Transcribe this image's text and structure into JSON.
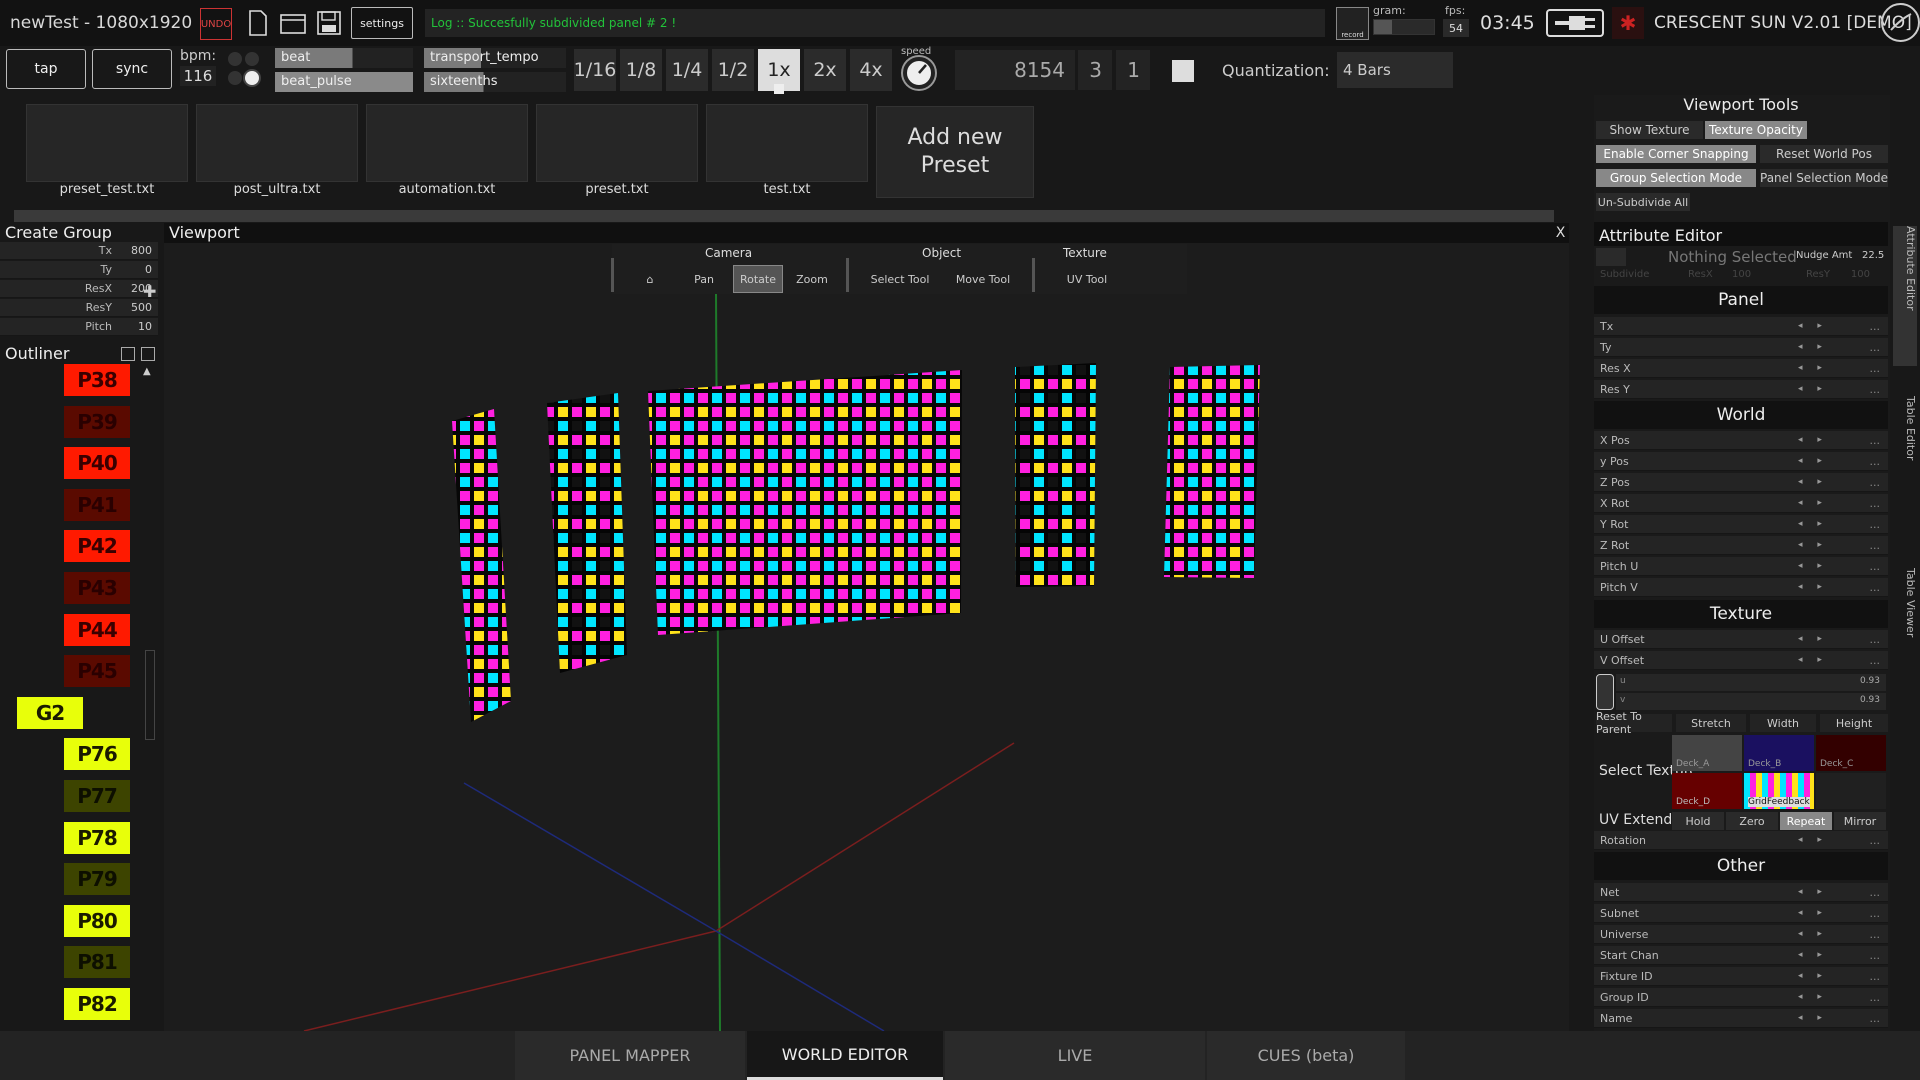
{
  "app": {
    "title": "newTest - 1080x1920",
    "undo_label": "UNDO",
    "settings_label": "settings",
    "log": "Log :: Succesfully subdivided panel # 2 !",
    "record_label": "record",
    "gram_label": "gram:",
    "fps_label": "fps:",
    "fps_value": "54",
    "clock": "03:45",
    "brand": "CRESCENT SUN V2.01 [DEMO]"
  },
  "transport": {
    "tap_label": "tap",
    "sync_label": "sync",
    "bpm_label": "bpm:",
    "bpm_value": "116",
    "slots": [
      "beat",
      "beat_pulse",
      "transport_tempo",
      "sixteenths"
    ],
    "divisions": [
      "1/16",
      "1/8",
      "1/4",
      "1/2",
      "1x",
      "2x",
      "4x"
    ],
    "active_division": "1x",
    "speed_label": "speed",
    "counter_main": "8154",
    "counter_b": "3",
    "counter_c": "1",
    "quant_label": "Quantization:",
    "quant_value": "4 Bars"
  },
  "presets": {
    "items": [
      "preset_test.txt",
      "post_ultra.txt",
      "automation.txt",
      "preset.txt",
      "test.txt"
    ],
    "add_label": "Add new Preset"
  },
  "create_group": {
    "title": "Create Group",
    "rows": [
      {
        "label": "Tx",
        "value": "800"
      },
      {
        "label": "Ty",
        "value": "0"
      },
      {
        "label": "ResX",
        "value": "200"
      },
      {
        "label": "ResY",
        "value": "500"
      },
      {
        "label": "Pitch",
        "value": "10"
      }
    ]
  },
  "outliner": {
    "title": "Outliner",
    "items": [
      {
        "label": "P38",
        "color": "#ff1a00",
        "text": "#3a0000",
        "indent": 0
      },
      {
        "label": "P39",
        "color": "#5a0a00",
        "text": "#2a0000",
        "indent": 0
      },
      {
        "label": "P40",
        "color": "#ff1a00",
        "text": "#3a0000",
        "indent": 0
      },
      {
        "label": "P41",
        "color": "#5a0a00",
        "text": "#2a0000",
        "indent": 0
      },
      {
        "label": "P42",
        "color": "#ff1a00",
        "text": "#3a0000",
        "indent": 0
      },
      {
        "label": "P43",
        "color": "#5a0a00",
        "text": "#2a0000",
        "indent": 0
      },
      {
        "label": "P44",
        "color": "#ff1a00",
        "text": "#3a0000",
        "indent": 0
      },
      {
        "label": "P45",
        "color": "#5a0a00",
        "text": "#2a0000",
        "indent": 0
      },
      {
        "label": "G2",
        "color": "#e8ff0a",
        "text": "#1a1a00",
        "indent": -1
      },
      {
        "label": "P76",
        "color": "#e8ff0a",
        "text": "#1a1a00",
        "indent": 0
      },
      {
        "label": "P77",
        "color": "#3d4400",
        "text": "#0d0f00",
        "indent": 0
      },
      {
        "label": "P78",
        "color": "#e8ff0a",
        "text": "#1a1a00",
        "indent": 0
      },
      {
        "label": "P79",
        "color": "#3d4400",
        "text": "#0d0f00",
        "indent": 0
      },
      {
        "label": "P80",
        "color": "#e8ff0a",
        "text": "#1a1a00",
        "indent": 0
      },
      {
        "label": "P81",
        "color": "#3d4400",
        "text": "#0d0f00",
        "indent": 0
      },
      {
        "label": "P82",
        "color": "#e8ff0a",
        "text": "#1a1a00",
        "indent": 0
      }
    ]
  },
  "viewport": {
    "title": "Viewport",
    "close_label": "X",
    "groups": {
      "camera": "Camera",
      "object": "Object",
      "texture": "Texture"
    },
    "tools": {
      "pan": "Pan",
      "rotate": "Rotate",
      "zoom": "Zoom",
      "select": "Select Tool",
      "move": "Move Tool",
      "uv": "UV Tool"
    }
  },
  "viewport_tools": {
    "title": "Viewport Tools",
    "show_texture": "Show Texture",
    "texture_opacity": "Texture Opacity",
    "corner_snapping": "Enable Corner Snapping",
    "reset_world_pos": "Reset World Pos",
    "group_selection": "Group Selection Mode",
    "panel_selection": "Panel Selection Mode",
    "unsubdivide": "Un-Subdivide All"
  },
  "attribute_editor": {
    "title": "Attribute Editor",
    "nothing_selected": "Nothing Selected",
    "nudge_label": "Nudge Amt",
    "nudge_value": "22.5",
    "sub_headers": [
      "Subdivide",
      "ResX",
      "100",
      "ResY",
      "100"
    ],
    "sections": {
      "panel": {
        "title": "Panel",
        "rows": [
          "Tx",
          "Ty",
          "Res X",
          "Res Y"
        ]
      },
      "world": {
        "title": "World",
        "rows": [
          "X Pos",
          "y Pos",
          "Z Pos",
          "X Rot",
          "Y Rot",
          "Z Rot",
          "Pitch U",
          "Pitch V"
        ]
      },
      "texture": {
        "title": "Texture",
        "rows": [
          "U Offset",
          "V Offset"
        ]
      },
      "other": {
        "title": "Other",
        "rows": [
          "Net",
          "Subnet",
          "Universe",
          "Start Chan",
          "Fixture ID",
          "Group ID",
          "Name"
        ]
      }
    },
    "uv": {
      "u_label": "u",
      "v_label": "v",
      "u_value": "0.93",
      "v_value": "0.93"
    },
    "fit_buttons": [
      "Reset To Parent",
      "Stretch",
      "Width",
      "Height"
    ],
    "select_texture": "Select Texture",
    "decks": [
      "Deck_A",
      "Deck_B",
      "Deck_C",
      "Deck_D",
      "GridFeedback"
    ],
    "uv_extend_label": "UV Extend",
    "uv_extend_options": [
      "Hold",
      "Zero",
      "Repeat",
      "Mirror"
    ],
    "uv_extend_active": "Repeat",
    "rotation_label": "Rotation"
  },
  "side_tabs": [
    "Attribute Editor",
    "Table Editor",
    "Table Viewer"
  ],
  "bottom_tabs": [
    "PANEL MAPPER",
    "WORLD EDITOR",
    "LIVE",
    "CUES (beta)"
  ],
  "bottom_active": "WORLD EDITOR",
  "colors": {
    "log_green": "#22c33a",
    "undo_red": "#dd3333",
    "panel_cyan": "#00e5ff",
    "panel_magenta": "#ff20e0",
    "panel_yellow": "#ffe21a"
  }
}
